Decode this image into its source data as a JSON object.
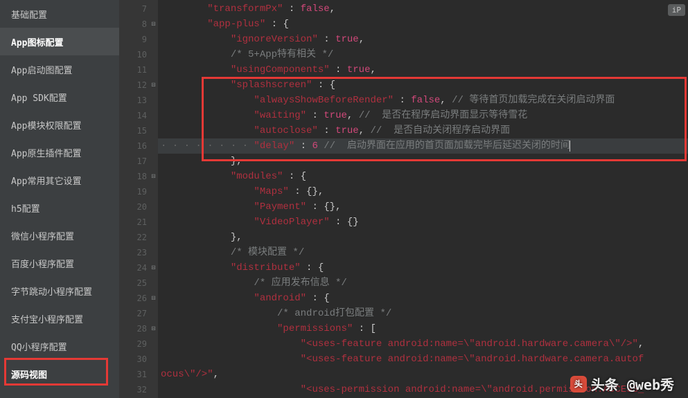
{
  "sidebar": {
    "items": [
      {
        "label": "基础配置",
        "active": false
      },
      {
        "label": "App图标配置",
        "active": true
      },
      {
        "label": "App启动图配置",
        "active": false
      },
      {
        "label": "App SDK配置",
        "active": false
      },
      {
        "label": "App模块权限配置",
        "active": false
      },
      {
        "label": "App原生插件配置",
        "active": false
      },
      {
        "label": "App常用其它设置",
        "active": false
      },
      {
        "label": "h5配置",
        "active": false
      },
      {
        "label": "微信小程序配置",
        "active": false
      },
      {
        "label": "百度小程序配置",
        "active": false
      },
      {
        "label": "字节跳动小程序配置",
        "active": false
      },
      {
        "label": "支付宝小程序配置",
        "active": false
      },
      {
        "label": "QQ小程序配置",
        "active": false
      },
      {
        "label": "源码视图",
        "active": false,
        "source_view": true
      }
    ]
  },
  "editor": {
    "pill": "iP",
    "lines": [
      {
        "num": 7,
        "fold": "",
        "indent": 2,
        "tokens": [
          [
            "key",
            "\"transformPx\""
          ],
          [
            "punc",
            " : "
          ],
          [
            "bool",
            "false"
          ],
          [
            "punc",
            ","
          ]
        ]
      },
      {
        "num": 8,
        "fold": "⊟",
        "indent": 2,
        "tokens": [
          [
            "key",
            "\"app-plus\""
          ],
          [
            "punc",
            " : {"
          ]
        ]
      },
      {
        "num": 9,
        "fold": "",
        "indent": 3,
        "tokens": [
          [
            "key",
            "\"ignoreVersion\""
          ],
          [
            "punc",
            " : "
          ],
          [
            "bool",
            "true"
          ],
          [
            "punc",
            ","
          ]
        ]
      },
      {
        "num": 10,
        "fold": "",
        "indent": 3,
        "tokens": [
          [
            "comm",
            "/* 5+App特有相关 */"
          ]
        ]
      },
      {
        "num": 11,
        "fold": "",
        "indent": 3,
        "tokens": [
          [
            "key",
            "\"usingComponents\""
          ],
          [
            "punc",
            " : "
          ],
          [
            "bool",
            "true"
          ],
          [
            "punc",
            ","
          ]
        ]
      },
      {
        "num": 12,
        "fold": "⊟",
        "indent": 3,
        "tokens": [
          [
            "key",
            "\"splashscreen\""
          ],
          [
            "punc",
            " : {"
          ]
        ]
      },
      {
        "num": 13,
        "fold": "",
        "indent": 4,
        "tokens": [
          [
            "key",
            "\"alwaysShowBeforeRender\""
          ],
          [
            "punc",
            " : "
          ],
          [
            "bool",
            "false"
          ],
          [
            "punc",
            ", "
          ],
          [
            "comm",
            "// 等待首页加载完成在关闭启动界面"
          ]
        ]
      },
      {
        "num": 14,
        "fold": "",
        "indent": 4,
        "tokens": [
          [
            "key",
            "\"waiting\""
          ],
          [
            "punc",
            " : "
          ],
          [
            "bool",
            "true"
          ],
          [
            "punc",
            ", "
          ],
          [
            "comm",
            "//  是否在程序启动界面显示等待雪花"
          ]
        ]
      },
      {
        "num": 15,
        "fold": "",
        "indent": 4,
        "tokens": [
          [
            "key",
            "\"autoclose\""
          ],
          [
            "punc",
            " : "
          ],
          [
            "bool",
            "true"
          ],
          [
            "punc",
            ", "
          ],
          [
            "comm",
            "//  是否自动关闭程序启动界面"
          ]
        ]
      },
      {
        "num": 16,
        "fold": "",
        "indent": 4,
        "hl": true,
        "tokens": [
          [
            "key",
            "\"delay\""
          ],
          [
            "punc",
            " : "
          ],
          [
            "num",
            "6"
          ],
          [
            "punc",
            " "
          ],
          [
            "comm",
            "//  启动界面在应用的首页面加载完毕后延迟关闭的时间"
          ]
        ],
        "caret": true
      },
      {
        "num": 17,
        "fold": "",
        "indent": 3,
        "tokens": [
          [
            "punc",
            "},"
          ]
        ]
      },
      {
        "num": 18,
        "fold": "⊟",
        "indent": 3,
        "tokens": [
          [
            "key",
            "\"modules\""
          ],
          [
            "punc",
            " : {"
          ]
        ]
      },
      {
        "num": 19,
        "fold": "",
        "indent": 4,
        "tokens": [
          [
            "key",
            "\"Maps\""
          ],
          [
            "punc",
            " : {},"
          ]
        ]
      },
      {
        "num": 20,
        "fold": "",
        "indent": 4,
        "tokens": [
          [
            "key",
            "\"Payment\""
          ],
          [
            "punc",
            " : {},"
          ]
        ]
      },
      {
        "num": 21,
        "fold": "",
        "indent": 4,
        "tokens": [
          [
            "key",
            "\"VideoPlayer\""
          ],
          [
            "punc",
            " : {}"
          ]
        ]
      },
      {
        "num": 22,
        "fold": "",
        "indent": 3,
        "tokens": [
          [
            "punc",
            "},"
          ]
        ]
      },
      {
        "num": 23,
        "fold": "",
        "indent": 3,
        "tokens": [
          [
            "comm",
            "/* 模块配置 */"
          ]
        ]
      },
      {
        "num": 24,
        "fold": "⊟",
        "indent": 3,
        "tokens": [
          [
            "key",
            "\"distribute\""
          ],
          [
            "punc",
            " : {"
          ]
        ]
      },
      {
        "num": 25,
        "fold": "",
        "indent": 4,
        "tokens": [
          [
            "comm",
            "/* 应用发布信息 */"
          ]
        ]
      },
      {
        "num": 26,
        "fold": "⊟",
        "indent": 4,
        "tokens": [
          [
            "key",
            "\"android\""
          ],
          [
            "punc",
            " : {"
          ]
        ]
      },
      {
        "num": 27,
        "fold": "",
        "indent": 5,
        "tokens": [
          [
            "comm",
            "/* android打包配置 */"
          ]
        ]
      },
      {
        "num": 28,
        "fold": "⊟",
        "indent": 5,
        "tokens": [
          [
            "key",
            "\"permissions\""
          ],
          [
            "punc",
            " : ["
          ]
        ]
      },
      {
        "num": 29,
        "fold": "",
        "indent": 6,
        "tokens": [
          [
            "key",
            "\"<uses-feature android:name=\\\"android.hardware.camera\\\"/>\""
          ],
          [
            "punc",
            ","
          ]
        ]
      },
      {
        "num": 30,
        "fold": "",
        "indent": 6,
        "tokens": [
          [
            "key",
            "\"<uses-feature android:name=\\\"android.hardware.camera.autof"
          ]
        ]
      },
      {
        "num": 31,
        "fold": "",
        "indent": 0,
        "tokens": [
          [
            "key",
            "ocus\\\"/>\""
          ],
          [
            "punc",
            ","
          ]
        ]
      },
      {
        "num": 32,
        "fold": "",
        "indent": 6,
        "tokens": [
          [
            "key",
            "\"<uses-permission android:name=\\\"android.permission.ACCESS_"
          ]
        ]
      }
    ]
  },
  "watermark": {
    "text": "头条 @web秀"
  }
}
